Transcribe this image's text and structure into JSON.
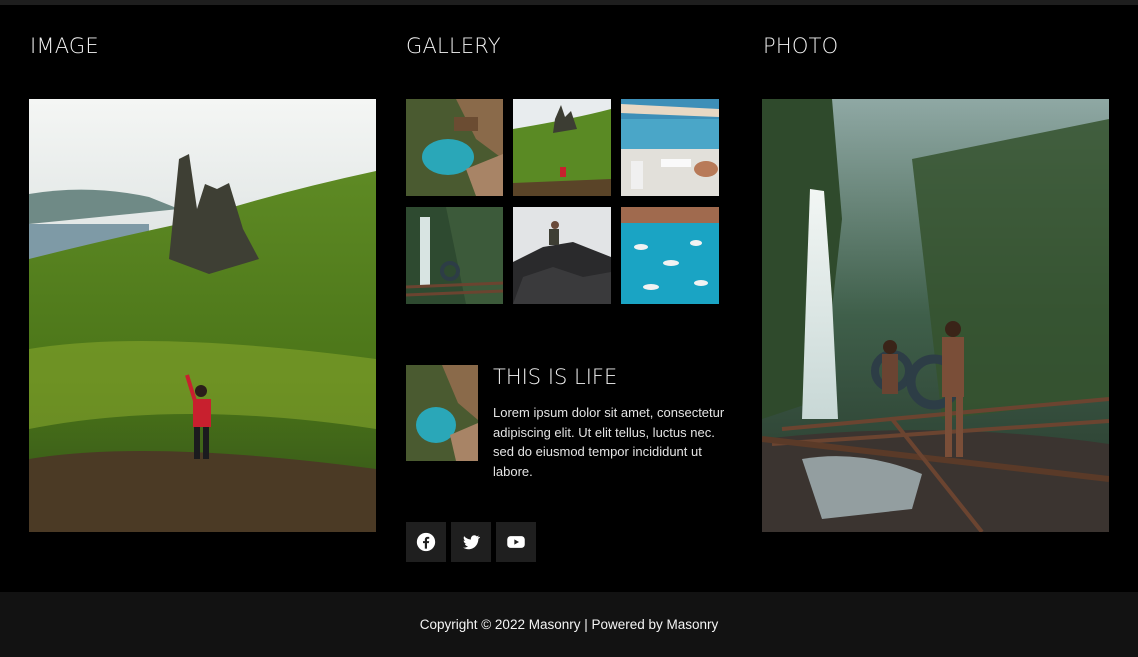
{
  "columns": {
    "image_title": "IMAGE",
    "gallery_title": "GALLERY",
    "photo_title": "PHOTO"
  },
  "feature": {
    "title": "THIS IS LIFE",
    "text": "Lorem ipsum dolor sit amet, consectetur adipiscing elit. Ut elit tellus, luctus nec. sed do eiusmod tempor incididunt ut labore."
  },
  "social": [
    "facebook-icon",
    "twitter-icon",
    "youtube-icon"
  ],
  "footer": {
    "text": "Copyright © 2022 Masonry | Powered by Masonry"
  },
  "colors": {
    "background": "#000000",
    "footer_bg": "#121212",
    "social_bg": "#1f1f1f",
    "text": "#ffffff"
  }
}
